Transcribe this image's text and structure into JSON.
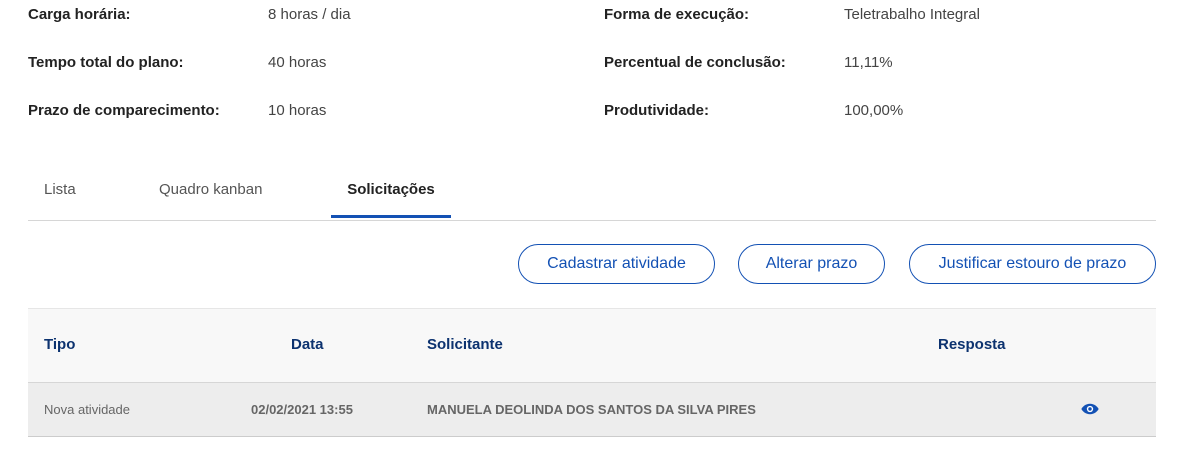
{
  "info": {
    "carga_label": "Carga horária:",
    "carga_value": "8 horas / dia",
    "forma_label": "Forma de execução:",
    "forma_value": "Teletrabalho Integral",
    "tempo_label": "Tempo total do plano:",
    "tempo_value": "40 horas",
    "percentual_label": "Percentual de conclusão:",
    "percentual_value": "11,11%",
    "prazo_label": "Prazo de comparecimento:",
    "prazo_value": "10 horas",
    "produtividade_label": "Produtividade:",
    "produtividade_value": "100,00%"
  },
  "tabs": [
    {
      "label": "Lista",
      "active": false
    },
    {
      "label": "Quadro kanban",
      "active": false
    },
    {
      "label": "Solicitações",
      "active": true
    }
  ],
  "actions": {
    "cadastrar": "Cadastrar atividade",
    "alterar": "Alterar prazo",
    "justificar": "Justificar estouro de prazo"
  },
  "table": {
    "headers": {
      "tipo": "Tipo",
      "data": "Data",
      "solicitante": "Solicitante",
      "resposta": "Resposta"
    },
    "rows": [
      {
        "tipo": "Nova atividade",
        "data": "02/02/2021 13:55",
        "solicitante": "MANUELA DEOLINDA DOS SANTOS DA SILVA PIRES",
        "resposta_icon": "eye-icon"
      }
    ]
  },
  "colors": {
    "primary": "#1351b4",
    "header_text": "#0c326f"
  }
}
